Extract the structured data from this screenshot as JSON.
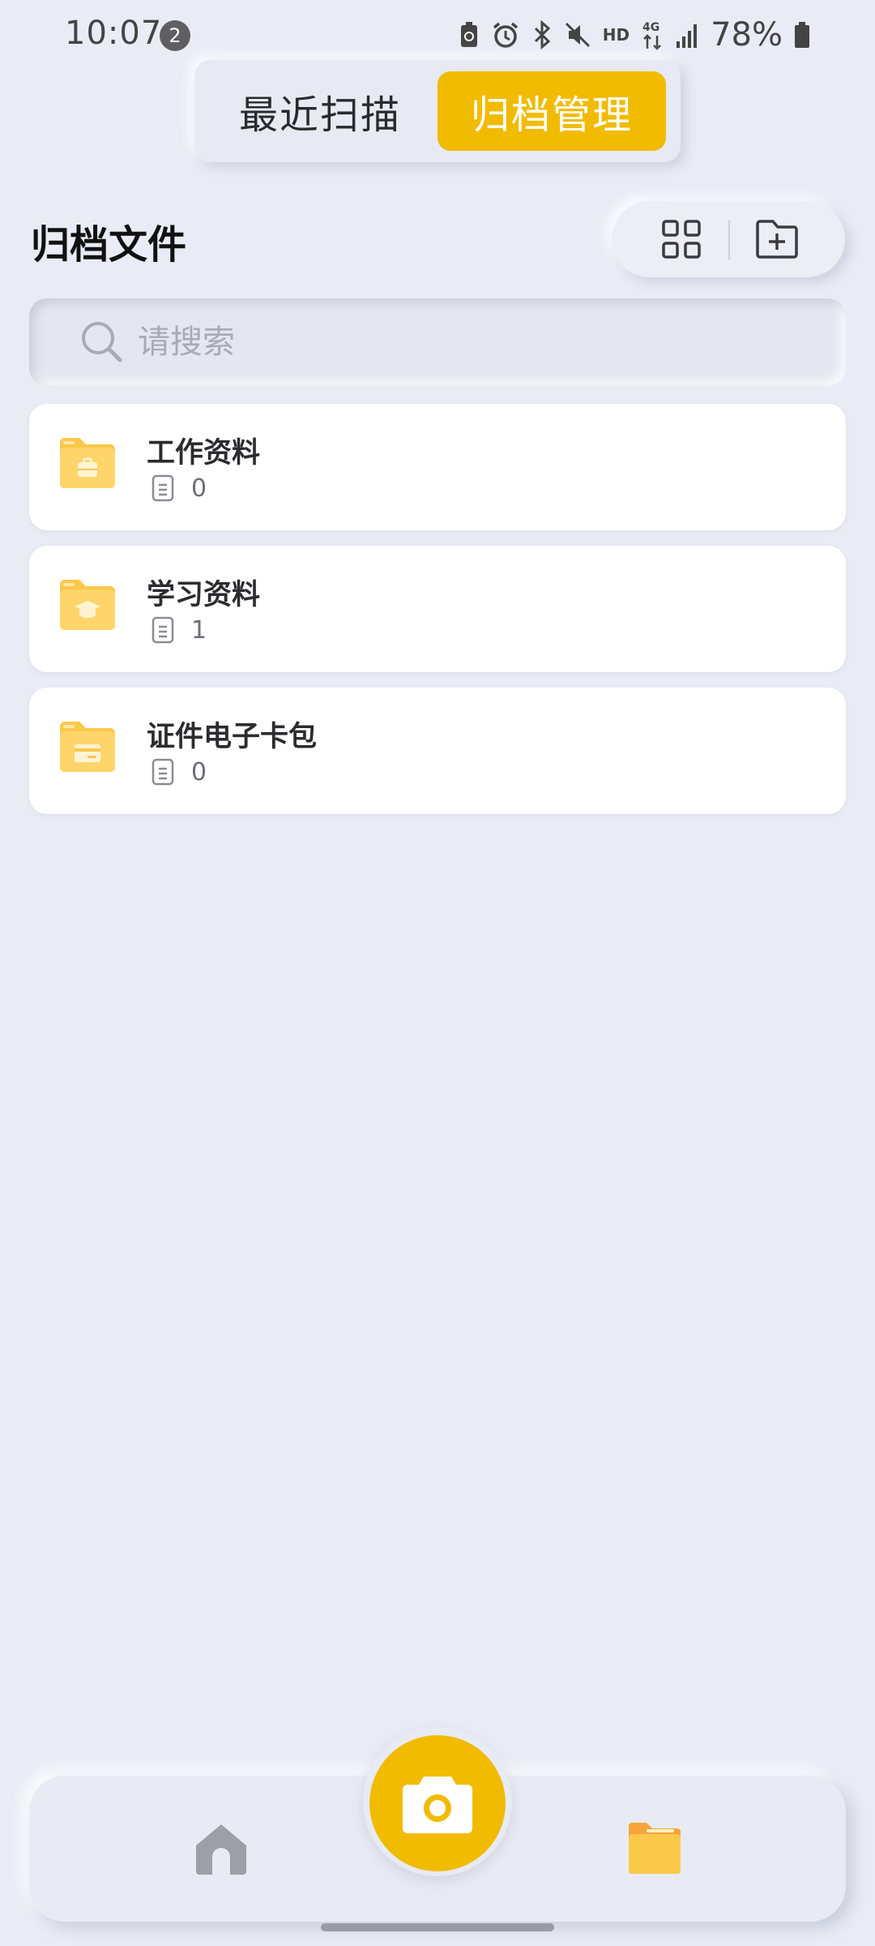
{
  "status_bar": {
    "time": "10:07",
    "notification_count": "2",
    "network_label": "HD",
    "network_type": "4G",
    "battery": "78%"
  },
  "mode_toggle": {
    "recent_label": "最近扫描",
    "archive_label": "归档管理",
    "active": "archive"
  },
  "header": {
    "title": "归档文件"
  },
  "search": {
    "placeholder": "请搜索"
  },
  "folders": [
    {
      "name": "工作资料",
      "count": "0",
      "icon": "briefcase-folder-icon"
    },
    {
      "name": "学习资料",
      "count": "1",
      "icon": "graduation-folder-icon"
    },
    {
      "name": "证件电子卡包",
      "count": "0",
      "icon": "card-folder-icon"
    }
  ],
  "bottom_nav": {
    "items": [
      "home-icon",
      "camera-icon",
      "archive-folder-icon"
    ],
    "active": "archive"
  },
  "colors": {
    "accent": "#f1bb00",
    "background": "#e9ecf5",
    "card": "#ffffff",
    "folder": "#fbc84a"
  }
}
